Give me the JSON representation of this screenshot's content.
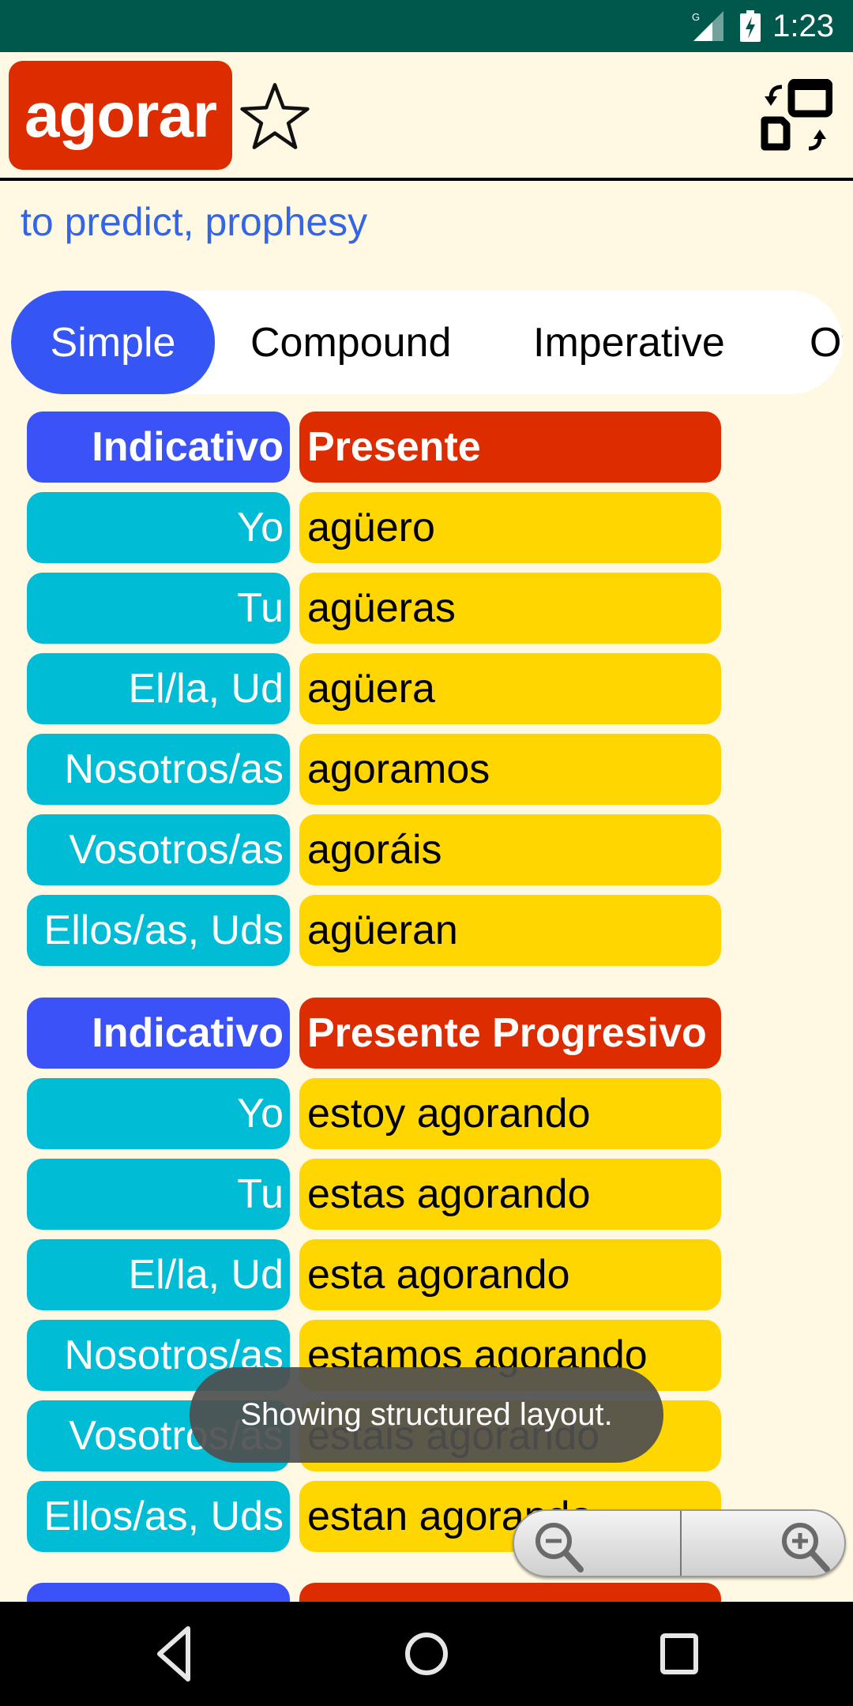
{
  "status_bar": {
    "time": "1:23",
    "network_label": "G",
    "icons": [
      "signal-icon",
      "battery-charging-icon"
    ]
  },
  "header": {
    "verb": "agorar",
    "favorite_icon": "star-outline-icon",
    "layout_toggle_icon": "swap-layout-icon",
    "translation": "to predict, prophesy"
  },
  "tabs": [
    {
      "label": "Simple",
      "active": true
    },
    {
      "label": "Compound",
      "active": false
    },
    {
      "label": "Imperative",
      "active": false
    },
    {
      "label": "Ot",
      "active": false
    }
  ],
  "sections": [
    {
      "mood": "Indicativo",
      "tense": "Presente",
      "rows": [
        {
          "pronoun": "Yo",
          "form": "agüero"
        },
        {
          "pronoun": "Tu",
          "form": "agüeras"
        },
        {
          "pronoun": "El/la, Ud",
          "form": "agüera"
        },
        {
          "pronoun": "Nosotros/as",
          "form": "agoramos"
        },
        {
          "pronoun": "Vosotros/as",
          "form": "agoráis"
        },
        {
          "pronoun": "Ellos/as, Uds",
          "form": "agüeran"
        }
      ]
    },
    {
      "mood": "Indicativo",
      "tense": "Presente Progresivo",
      "rows": [
        {
          "pronoun": "Yo",
          "form": "estoy agorando"
        },
        {
          "pronoun": "Tu",
          "form": "estas agorando"
        },
        {
          "pronoun": "El/la, Ud",
          "form": "esta agorando"
        },
        {
          "pronoun": "Nosotros/as",
          "form": "estamos agorando"
        },
        {
          "pronoun": "Vosotros/as",
          "form": "estais agorando"
        },
        {
          "pronoun": "Ellos/as, Uds",
          "form": "estan agorando"
        }
      ]
    },
    {
      "mood": "",
      "tense": "",
      "rows": []
    }
  ],
  "toast": {
    "message": "Showing structured layout."
  },
  "zoom_control": {
    "zoom_out_icon": "zoom-out-icon",
    "zoom_in_icon": "zoom-in-icon"
  },
  "nav_bar": {
    "buttons": [
      "back-icon",
      "home-icon",
      "recents-icon"
    ]
  },
  "colors": {
    "status_bar": "#00574B",
    "background": "#FFF8E2",
    "title_box": "#DD2C00",
    "translation": "#3366E6",
    "tab_active": "#3555F5",
    "mood_cell": "#3A52F7",
    "tense_cell": "#DD2C00",
    "pronoun_cell": "#00BCD4",
    "form_cell": "#FFD600"
  }
}
